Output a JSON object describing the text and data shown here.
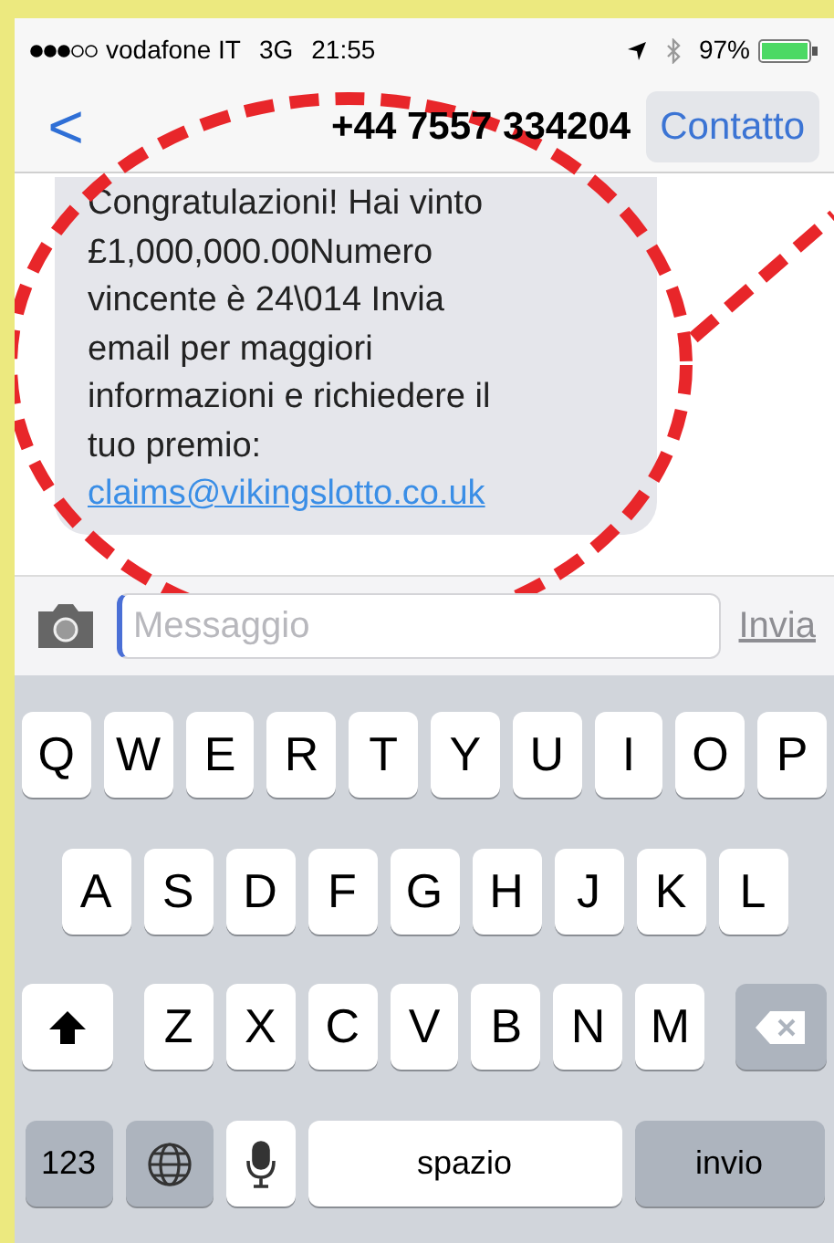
{
  "status_bar": {
    "carrier": "vodafone IT",
    "network": "3G",
    "time": "21:55",
    "battery": "97%"
  },
  "nav_bar": {
    "back": "<",
    "title": "+44 7557 334204",
    "contact_button": "Contatto"
  },
  "message": {
    "text": "Congratulazioni! Hai vinto\n£1,000,000.00Numero\nvincente è 24\\014 Invia\nemail per maggiori\ninformazioni e richiedere il\ntuo premio:",
    "link": "claims@vikingslotto.co.uk"
  },
  "input_bar": {
    "placeholder": "Messaggio",
    "send": "Invia"
  },
  "keyboard": {
    "key_rows": [
      [
        {
          "kind": "letter",
          "label": "Q"
        },
        {
          "kind": "letter",
          "label": "W"
        },
        {
          "kind": "letter",
          "label": "E"
        },
        {
          "kind": "letter",
          "label": "R"
        },
        {
          "kind": "letter",
          "label": "T"
        },
        {
          "kind": "letter",
          "label": "Y"
        },
        {
          "kind": "letter",
          "label": "U"
        },
        {
          "kind": "letter",
          "label": "I"
        },
        {
          "kind": "letter",
          "label": "O"
        },
        {
          "kind": "letter",
          "label": "P"
        }
      ],
      [
        {
          "kind": "letter",
          "label": "A"
        },
        {
          "kind": "letter",
          "label": "S"
        },
        {
          "kind": "letter",
          "label": "D"
        },
        {
          "kind": "letter",
          "label": "F"
        },
        {
          "kind": "letter",
          "label": "G"
        },
        {
          "kind": "letter",
          "label": "H"
        },
        {
          "kind": "letter",
          "label": "J"
        },
        {
          "kind": "letter",
          "label": "K"
        },
        {
          "kind": "letter",
          "label": "L"
        }
      ],
      [
        {
          "kind": "shift"
        },
        {
          "kind": "letter",
          "label": "Z"
        },
        {
          "kind": "letter",
          "label": "X"
        },
        {
          "kind": "letter",
          "label": "C"
        },
        {
          "kind": "letter",
          "label": "V"
        },
        {
          "kind": "letter",
          "label": "B"
        },
        {
          "kind": "letter",
          "label": "N"
        },
        {
          "kind": "letter",
          "label": "M"
        },
        {
          "kind": "delete"
        }
      ],
      [
        {
          "kind": "numbers",
          "label": "123"
        },
        {
          "kind": "globe"
        },
        {
          "kind": "mic"
        },
        {
          "kind": "space",
          "label": "spazio"
        },
        {
          "kind": "return",
          "label": "invio"
        }
      ]
    ]
  }
}
